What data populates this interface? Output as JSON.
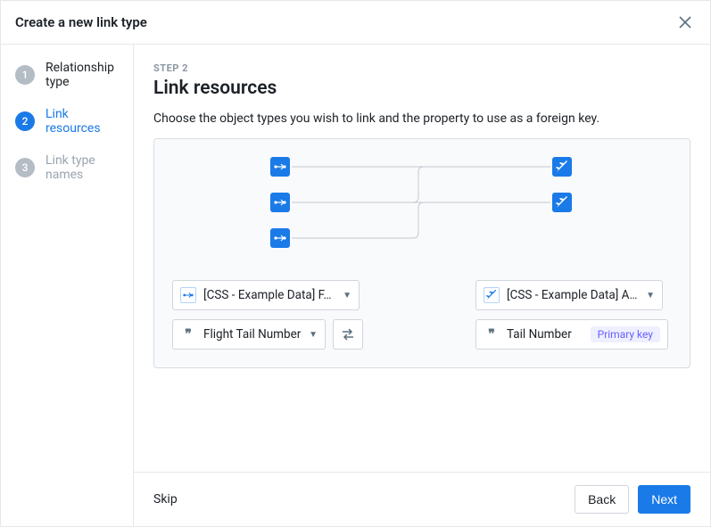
{
  "header": {
    "title": "Create a new link type"
  },
  "sidebar": {
    "steps": [
      {
        "num": "1",
        "label": "Relationship type",
        "state": "completed"
      },
      {
        "num": "2",
        "label": "Link resources",
        "state": "active"
      },
      {
        "num": "3",
        "label": "Link type names",
        "state": "inactive"
      }
    ]
  },
  "main": {
    "step_indicator": "STEP 2",
    "title": "Link resources",
    "description": "Choose the object types you wish to link and the property to use as a foreign key.",
    "left": {
      "object_label": "[CSS - Example Data] F…",
      "property_label": "Flight Tail Number"
    },
    "right": {
      "object_label": "[CSS - Example Data] A…",
      "property_label": "Tail Number",
      "badge": "Primary key"
    }
  },
  "footer": {
    "skip": "Skip",
    "back": "Back",
    "next": "Next"
  }
}
